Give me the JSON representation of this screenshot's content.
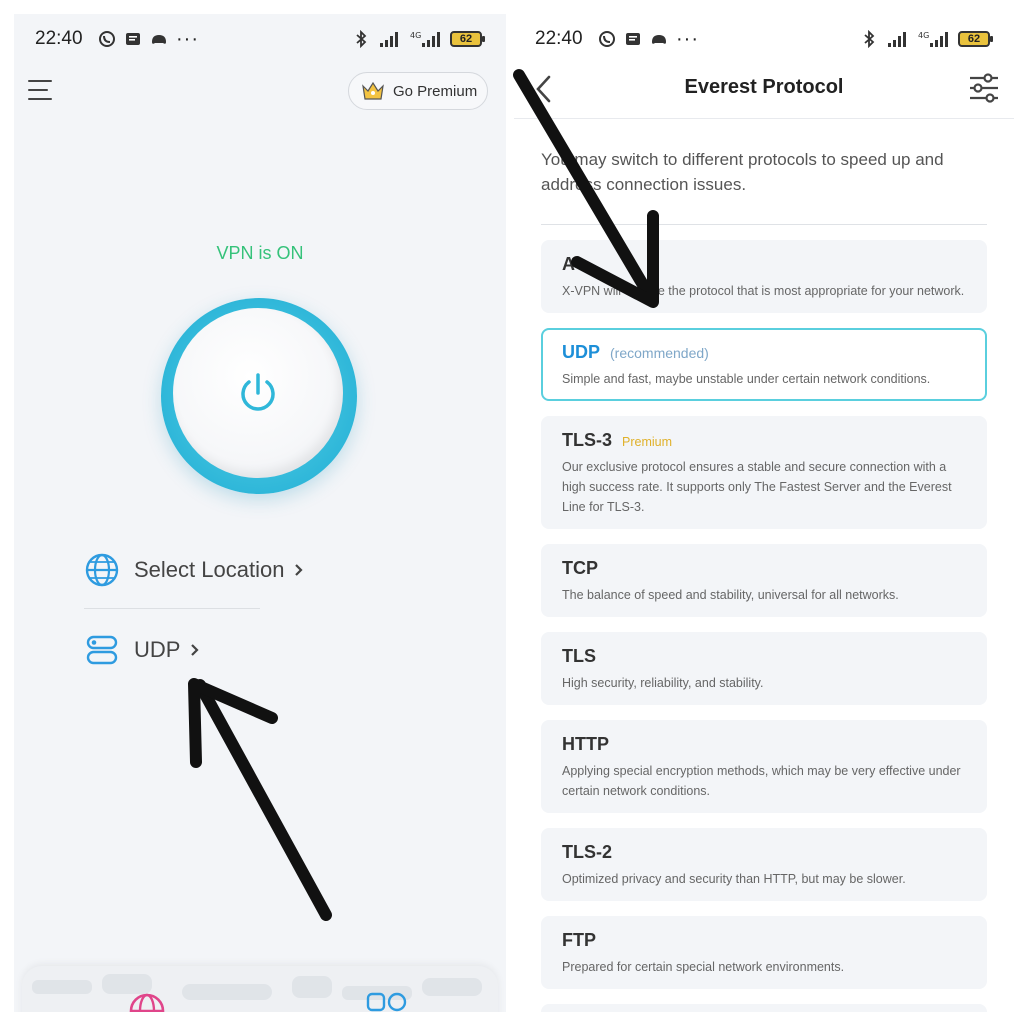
{
  "left_screen": {
    "status_bar": {
      "time": "22:40",
      "left_icons": [
        "whatsapp-icon",
        "message-icon",
        "game-icon"
      ],
      "more": "···",
      "network": "4G",
      "battery": "62"
    },
    "header": {
      "premium_label": "Go Premium"
    },
    "vpn_status": "VPN is ON",
    "select_location_label": "Select Location",
    "protocol_label": "UDP",
    "colors": {
      "accent": "#2fb7d9",
      "status_on": "#35c27a"
    }
  },
  "right_screen": {
    "status_bar": {
      "time": "22:40",
      "network": "4G",
      "battery": "62"
    },
    "title": "Everest Protocol",
    "description": "You may switch to different protocols to speed up and address connection issues.",
    "protocols": [
      {
        "name": "A",
        "tag": "",
        "description": "X-VPN will choose the protocol that is most appropriate for your network.",
        "selected": false
      },
      {
        "name": "UDP",
        "tag": "(recommended)",
        "description": "Simple and fast, maybe unstable under certain network conditions.",
        "selected": true
      },
      {
        "name": "TLS-3",
        "tag": "Premium",
        "description": "Our exclusive protocol ensures a stable and secure connection with a high success rate. It supports only The Fastest Server and the Everest Line for TLS-3.",
        "selected": false
      },
      {
        "name": "TCP",
        "tag": "",
        "description": "The balance of speed and stability, universal for all networks.",
        "selected": false
      },
      {
        "name": "TLS",
        "tag": "",
        "description": "High security, reliability, and stability.",
        "selected": false
      },
      {
        "name": "HTTP",
        "tag": "",
        "description": "Applying special encryption methods, which may be very effective under certain network conditions.",
        "selected": false
      },
      {
        "name": "TLS-2",
        "tag": "",
        "description": "Optimized privacy and security than HTTP, but may be slower.",
        "selected": false
      },
      {
        "name": "FTP",
        "tag": "",
        "description": "Prepared for certain special network environments.",
        "selected": false
      }
    ],
    "colors": {
      "selected_border": "#5acfde",
      "selected_name": "#1d8fd8",
      "premium": "#e0b12a"
    }
  }
}
